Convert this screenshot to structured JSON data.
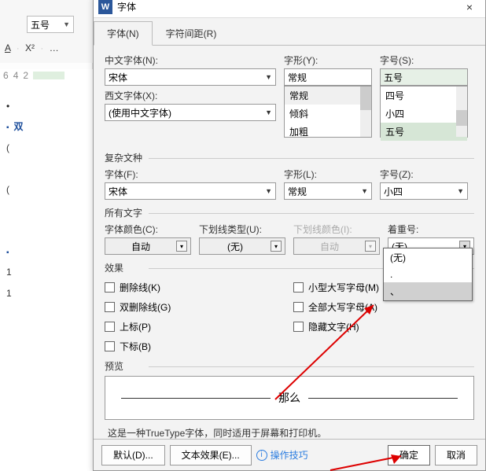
{
  "bg": {
    "font_size_combo": "五号",
    "row2": {
      "a_under": "A",
      "x2": "X²",
      "ellipsis": "…"
    },
    "ruler_marks": [
      "6",
      "4",
      "2"
    ],
    "doc_lines": [
      "双",
      "(",
      "",
      "(",
      "",
      "",
      "",
      ""
    ]
  },
  "dialog": {
    "title": "字体",
    "tabs": {
      "font": "字体(N)",
      "spacing": "字符间距(R)"
    },
    "chinese": {
      "label": "中文字体(N):",
      "value": "宋体"
    },
    "style": {
      "label": "字形(Y):",
      "value": "常规",
      "options": [
        "常规",
        "倾斜",
        "加粗"
      ]
    },
    "size": {
      "label": "字号(S):",
      "value": "五号",
      "options": [
        "四号",
        "小四",
        "五号"
      ]
    },
    "western": {
      "label": "西文字体(X):",
      "value": "(使用中文字体)"
    },
    "complex_section": "复杂文种",
    "complex_font": {
      "label": "字体(F):",
      "value": "宋体"
    },
    "complex_style": {
      "label": "字形(L):",
      "value": "常规"
    },
    "complex_size": {
      "label": "字号(Z):",
      "value": "小四"
    },
    "alltext_section": "所有文字",
    "font_color": {
      "label": "字体颜色(C):",
      "value": "自动"
    },
    "underline": {
      "label": "下划线类型(U):",
      "value": "(无)"
    },
    "underline_color": {
      "label": "下划线颜色(I):",
      "value": "自动"
    },
    "emphasis": {
      "label": "着重号:",
      "value": "(无)",
      "options": [
        "(无)",
        ".",
        "、"
      ]
    },
    "effects_section": "效果",
    "effects": {
      "strike": "删除线(K)",
      "dblstrike": "双删除线(G)",
      "superscript": "上标(P)",
      "subscript": "下标(B)",
      "smallcaps": "小型大写字母(M)",
      "allcaps": "全部大写字母(A)",
      "hidden": "隐藏文字(H)"
    },
    "preview_section": "预览",
    "preview_text": "那么",
    "preview_note": "这是一种TrueType字体，同时适用于屏幕和打印机。",
    "footer": {
      "default": "默认(D)...",
      "text_effect": "文本效果(E)...",
      "tips": "操作技巧",
      "ok": "确定",
      "cancel": "取消"
    }
  }
}
